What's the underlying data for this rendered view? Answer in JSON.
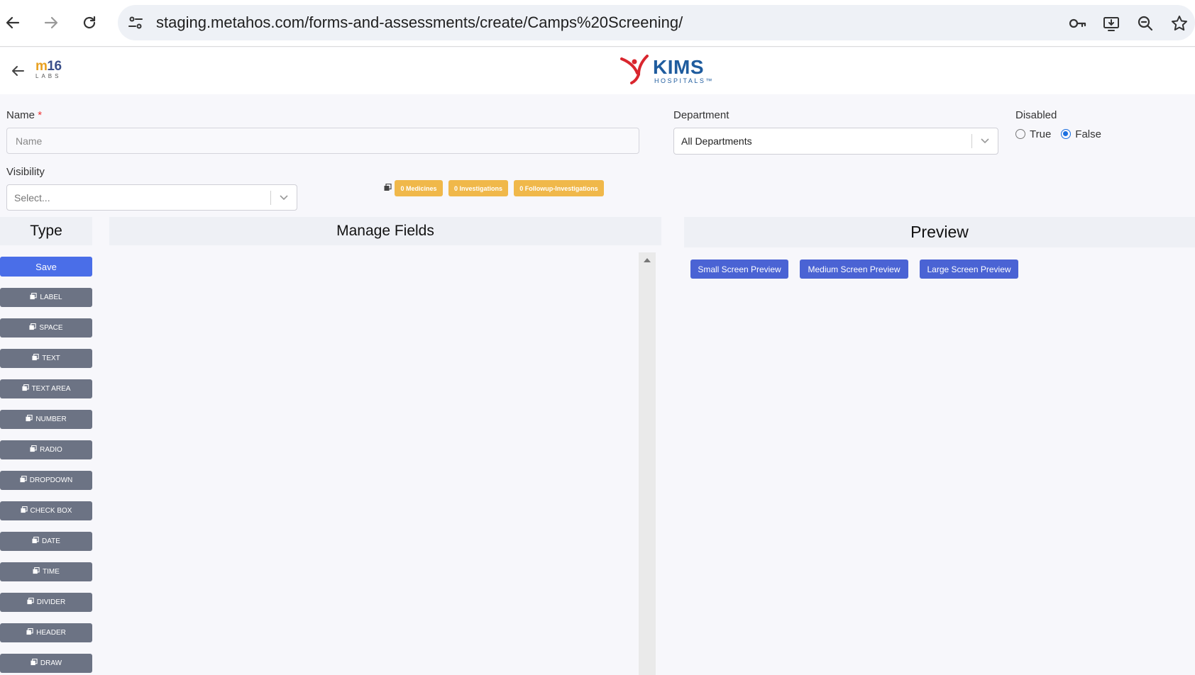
{
  "browser": {
    "url": "staging.metahos.com/forms-and-assessments/create/Camps%20Screening/"
  },
  "header": {
    "m16_m": "m",
    "m16_num": "16",
    "m16_labs": "LABS",
    "kims_name": "KIMS",
    "kims_sub": "HOSPITALS™"
  },
  "form": {
    "name_label": "Name",
    "name_required": "*",
    "name_placeholder": "Name",
    "department_label": "Department",
    "department_value": "All Departments",
    "disabled_label": "Disabled",
    "disabled_options": [
      "True",
      "False"
    ],
    "disabled_selected": "False",
    "visibility_label": "Visibility",
    "visibility_placeholder": "Select..."
  },
  "badges": {
    "medicines": "0 Medicines",
    "investigations": "0 Investigations",
    "followup": "0 Followup-Investigations"
  },
  "panels": {
    "type_title": "Type",
    "manage_title": "Manage Fields",
    "preview_title": "Preview",
    "save_label": "Save",
    "types": [
      "LABEL",
      "SPACE",
      "TEXT",
      "TEXT AREA",
      "NUMBER",
      "RADIO",
      "DROPDOWN",
      "CHECK BOX",
      "DATE",
      "TIME",
      "DIVIDER",
      "HEADER",
      "DRAW"
    ],
    "preview_buttons": [
      "Small Screen Preview",
      "Medium Screen Preview",
      "Large Screen Preview"
    ]
  },
  "colors": {
    "accent": "#4a6ee8",
    "badge": "#f0b84a",
    "type_button": "#6c7384"
  }
}
